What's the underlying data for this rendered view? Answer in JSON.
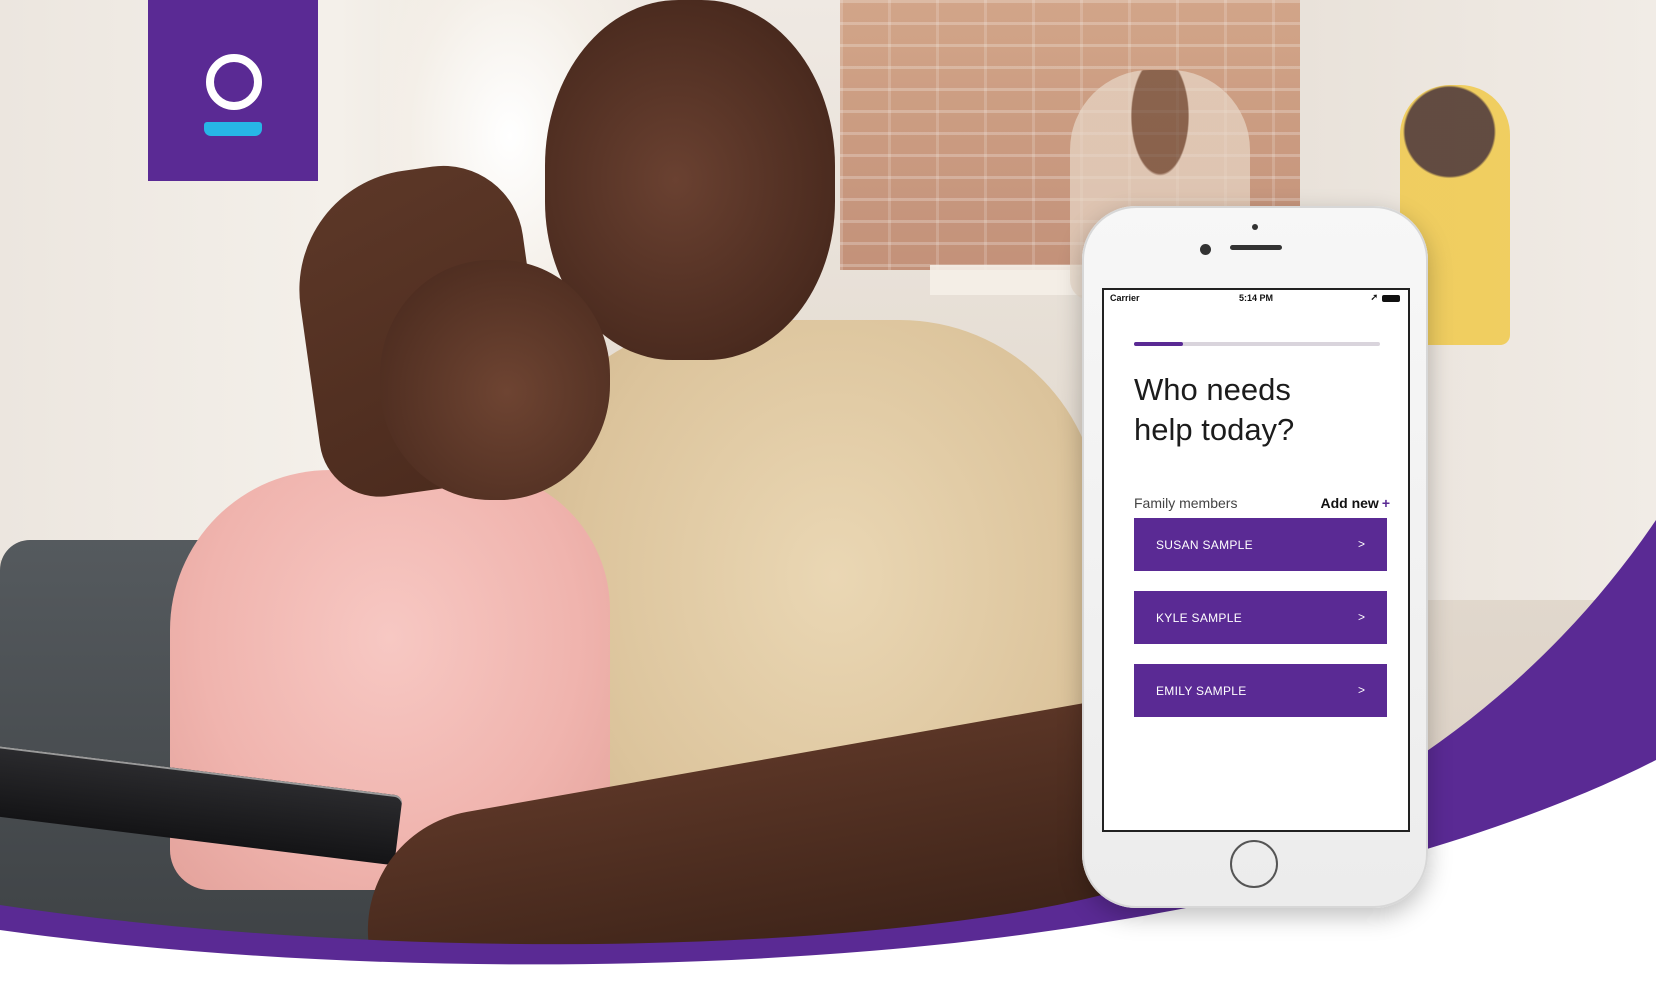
{
  "brand": {
    "logo_icon": "clover-person-logo",
    "color": "#5a2a94",
    "accent": "#27b6e6"
  },
  "phone": {
    "status": {
      "carrier": "Carrier",
      "time": "5:14 PM"
    },
    "progress": 0.2,
    "title_line1": "Who needs",
    "title_line2": "help today?",
    "section_label": "Family members",
    "add_new_label": "Add new",
    "add_new_icon": "+",
    "members": [
      {
        "name": "SUSAN SAMPLE",
        "chevron": ">"
      },
      {
        "name": "KYLE SAMPLE",
        "chevron": ">"
      },
      {
        "name": "EMILY SAMPLE",
        "chevron": ">"
      }
    ]
  }
}
